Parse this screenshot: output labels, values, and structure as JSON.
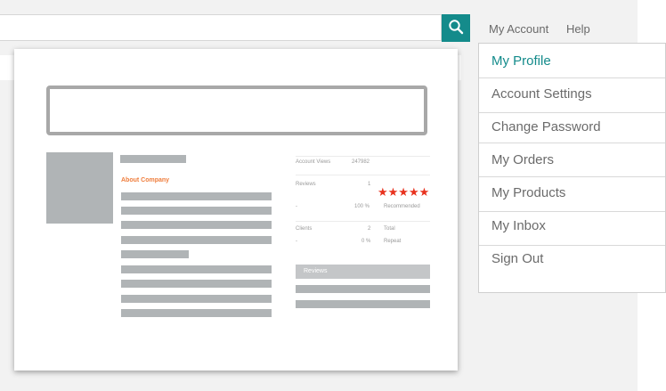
{
  "header": {
    "search": {
      "value": "",
      "placeholder": ""
    },
    "nav": {
      "my_account": "My Account",
      "help": "Help"
    },
    "icons": {
      "search": "search-icon"
    },
    "accent": "#148b8b"
  },
  "dropdown": {
    "items": [
      {
        "label": "My Profile",
        "active": true
      },
      {
        "label": "Account Settings"
      },
      {
        "label": "Change Password"
      },
      {
        "label": "My Orders"
      },
      {
        "label": "My Products"
      },
      {
        "label": "My Inbox"
      },
      {
        "label": "Sign Out"
      }
    ]
  },
  "preview": {
    "about_label": "About Company",
    "stats": {
      "account_views_label": "Account Views",
      "account_views_value": "247982",
      "reviews_label": "Reviews",
      "reviews_value": "1",
      "rating_stars": 5,
      "rating_text": "★★★★★",
      "recommended_dash": "-",
      "recommended_pct": "100 %",
      "recommended_label": "Recommended",
      "clients_label": "Clients",
      "clients_value": "2",
      "total_label": "Total",
      "repeat_dash": "-",
      "repeat_pct": "0 %",
      "repeat_label": "Repeat"
    },
    "reviews_header": "Reviews",
    "star_color": "#e8321e",
    "about_color": "#ef7d3c"
  }
}
